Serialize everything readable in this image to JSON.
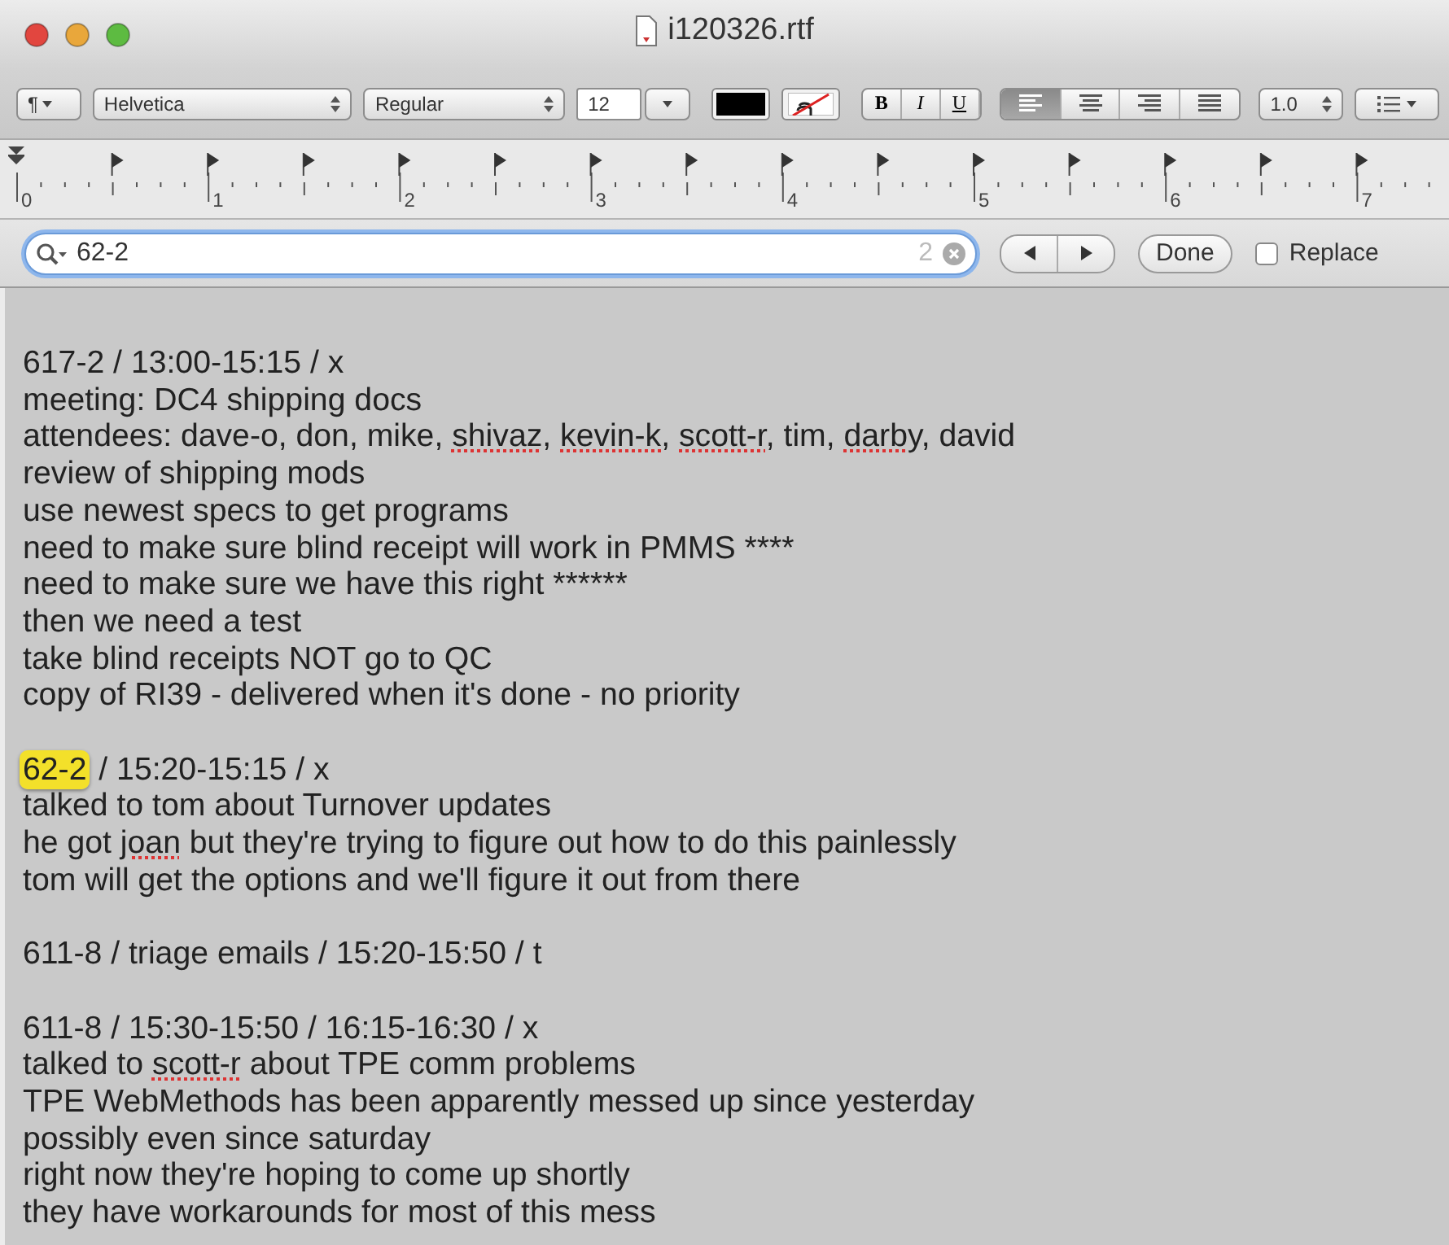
{
  "window": {
    "title": "i120326.rtf"
  },
  "toolbar": {
    "paragraph_menu": "¶",
    "font_family": "Helvetica",
    "typeface": "Regular",
    "font_size": "12",
    "bold": "B",
    "italic": "I",
    "underline": "U",
    "alignments": [
      {
        "kind": "left",
        "selected": true
      },
      {
        "kind": "center",
        "selected": false
      },
      {
        "kind": "right",
        "selected": false
      },
      {
        "kind": "justify",
        "selected": false
      }
    ],
    "line_spacing": "1.0"
  },
  "ruler": {
    "labels": [
      "0",
      "1",
      "2",
      "3",
      "4",
      "5",
      "6",
      "7"
    ]
  },
  "find_bar": {
    "query": "62-2",
    "match_count": "2",
    "done": "Done",
    "replace": {
      "label": "Replace",
      "checked": false
    }
  },
  "document": {
    "paragraphs": [
      {
        "lines": [
          {
            "segments": [
              {
                "kind": "plain",
                "text": "617-2 / 13:00-15:15 / x"
              }
            ]
          },
          {
            "segments": [
              {
                "kind": "plain",
                "text": "meeting: DC4 shipping docs"
              }
            ]
          },
          {
            "segments": [
              {
                "kind": "plain",
                "text": "attendees: dave-o, don, mike, "
              },
              {
                "kind": "misspelled",
                "text": "shivaz"
              },
              {
                "kind": "plain",
                "text": ", "
              },
              {
                "kind": "misspelled",
                "text": "kevin-k"
              },
              {
                "kind": "plain",
                "text": ", "
              },
              {
                "kind": "misspelled",
                "text": "scott-r"
              },
              {
                "kind": "plain",
                "text": ", tim, "
              },
              {
                "kind": "misspelled",
                "text": "darby"
              },
              {
                "kind": "plain",
                "text": ", david"
              }
            ]
          },
          {
            "segments": [
              {
                "kind": "plain",
                "text": "review of shipping mods"
              }
            ]
          },
          {
            "segments": [
              {
                "kind": "plain",
                "text": "use newest specs to get programs"
              }
            ]
          },
          {
            "segments": [
              {
                "kind": "plain",
                "text": "need to make sure blind receipt will work in PMMS ****"
              }
            ]
          },
          {
            "segments": [
              {
                "kind": "plain",
                "text": "need to make sure we have this right ******"
              }
            ]
          },
          {
            "segments": [
              {
                "kind": "plain",
                "text": "then we need a test"
              }
            ]
          },
          {
            "segments": [
              {
                "kind": "plain",
                "text": "take blind receipts NOT go to QC"
              }
            ]
          },
          {
            "segments": [
              {
                "kind": "plain",
                "text": "copy of RI39 - delivered when it's done - no priority"
              }
            ]
          }
        ]
      },
      {
        "lines": [
          {
            "segments": [
              {
                "kind": "match",
                "text": "62-2"
              },
              {
                "kind": "plain",
                "text": " / 15:20-15:15 / x"
              }
            ]
          },
          {
            "segments": [
              {
                "kind": "plain",
                "text": "talked to tom about Turnover updates"
              }
            ]
          },
          {
            "segments": [
              {
                "kind": "plain",
                "text": "he got "
              },
              {
                "kind": "misspelled",
                "text": "joan"
              },
              {
                "kind": "plain",
                "text": " but they're trying to figure out how to do this painlessly"
              }
            ]
          },
          {
            "segments": [
              {
                "kind": "plain",
                "text": "tom will get the options and we'll figure it out from there"
              }
            ]
          }
        ]
      },
      {
        "lines": [
          {
            "segments": [
              {
                "kind": "plain",
                "text": "611-8 / triage emails / 15:20-15:50 / t"
              }
            ]
          }
        ]
      },
      {
        "lines": [
          {
            "segments": [
              {
                "kind": "plain",
                "text": "611-8 / 15:30-15:50 / 16:15-16:30 / x"
              }
            ]
          },
          {
            "segments": [
              {
                "kind": "plain",
                "text": "talked to "
              },
              {
                "kind": "misspelled",
                "text": "scott-r"
              },
              {
                "kind": "plain",
                "text": " about TPE comm problems"
              }
            ]
          },
          {
            "segments": [
              {
                "kind": "plain",
                "text": "TPE WebMethods has been apparently messed up since yesterday"
              }
            ]
          },
          {
            "segments": [
              {
                "kind": "plain",
                "text": "possibly even since saturday"
              }
            ]
          },
          {
            "segments": [
              {
                "kind": "plain",
                "text": "right now they're hoping to come up shortly"
              }
            ]
          },
          {
            "segments": [
              {
                "kind": "plain",
                "text": "they have workarounds for most of this mess"
              }
            ]
          }
        ]
      }
    ]
  }
}
